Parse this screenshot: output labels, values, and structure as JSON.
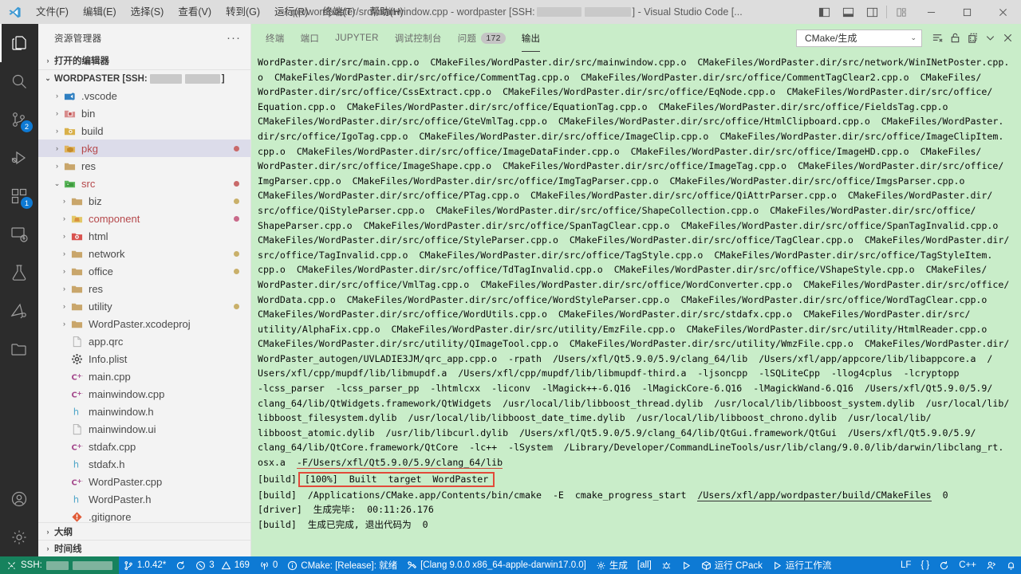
{
  "titlebar": {
    "menus": [
      "文件(F)",
      "编辑(E)",
      "选择(S)",
      "查看(V)",
      "转到(G)",
      "运行(R)",
      "终端(T)",
      "帮助(H)"
    ],
    "title_prefix": "~/app/wordpaster/src/mainwindow.cpp - wordpaster [SSH:",
    "title_suffix": "] - Visual Studio Code [...",
    "layout_icons": [
      "toggle-primary-sidebar-icon",
      "toggle-panel-icon",
      "toggle-secondary-sidebar-icon",
      "customize-layout-icon"
    ],
    "window_controls": [
      "minimize",
      "maximize",
      "close"
    ]
  },
  "activitybar": {
    "items": [
      {
        "name": "explorer",
        "icon": "files-icon",
        "badge": "",
        "active": true
      },
      {
        "name": "search",
        "icon": "search-icon",
        "badge": "",
        "active": false
      },
      {
        "name": "source-control",
        "icon": "source-control-icon",
        "badge": "2",
        "active": false
      },
      {
        "name": "run-and-debug",
        "icon": "debug-icon",
        "badge": "",
        "active": false
      },
      {
        "name": "extensions",
        "icon": "extensions-icon",
        "badge": "1",
        "active": false
      },
      {
        "name": "remote-explorer",
        "icon": "remote-explorer-icon",
        "badge": "",
        "active": false
      },
      {
        "name": "testing",
        "icon": "beaker-icon",
        "badge": "",
        "active": false
      },
      {
        "name": "cmake-tools",
        "icon": "cmake-icon",
        "badge": "",
        "active": false
      },
      {
        "name": "project-manager",
        "icon": "folder-icon",
        "badge": "",
        "active": false
      }
    ],
    "bottom_items": [
      {
        "name": "accounts",
        "icon": "account-icon"
      },
      {
        "name": "manage",
        "icon": "gear-icon"
      }
    ]
  },
  "sidebar": {
    "title": "资源管理器",
    "more_actions": "···",
    "open_editors": "打开的编辑器",
    "workspace_prefix": "WORDPASTER [SSH:",
    "workspace_suffix": "]",
    "outline": "大纲",
    "timeline": "时间线",
    "tree": [
      {
        "label": ".vscode",
        "indent": 1,
        "type": "folder",
        "icon": "vscode-folder-icon",
        "twisty": "›",
        "dot": ""
      },
      {
        "label": "bin",
        "indent": 1,
        "type": "folder",
        "icon": "bin-folder-icon",
        "twisty": "›",
        "dot": ""
      },
      {
        "label": "build",
        "indent": 1,
        "type": "folder",
        "icon": "build-folder-icon",
        "twisty": "›",
        "dot": ""
      },
      {
        "label": "pkg",
        "indent": 1,
        "type": "folder",
        "icon": "pkg-folder-icon",
        "twisty": "›",
        "dot": "#c96a6a",
        "selected": true,
        "color": "#b5484b"
      },
      {
        "label": "res",
        "indent": 1,
        "type": "folder",
        "icon": "folder-icon",
        "twisty": "›",
        "dot": ""
      },
      {
        "label": "src",
        "indent": 1,
        "type": "folder",
        "icon": "src-folder-icon",
        "twisty": "⌄",
        "dot": "#c96a6a",
        "color": "#b5484b"
      },
      {
        "label": "biz",
        "indent": 2,
        "type": "folder",
        "icon": "folder-icon",
        "twisty": "›",
        "dot": "#c9b06a"
      },
      {
        "label": "component",
        "indent": 2,
        "type": "folder",
        "icon": "component-folder-icon",
        "twisty": "›",
        "dot": "#c96a8a",
        "color": "#b5484b"
      },
      {
        "label": "html",
        "indent": 2,
        "type": "folder",
        "icon": "html-folder-icon",
        "twisty": "›",
        "dot": ""
      },
      {
        "label": "network",
        "indent": 2,
        "type": "folder",
        "icon": "folder-icon",
        "twisty": "›",
        "dot": "#c9b06a"
      },
      {
        "label": "office",
        "indent": 2,
        "type": "folder",
        "icon": "folder-icon",
        "twisty": "›",
        "dot": "#c9b06a"
      },
      {
        "label": "res",
        "indent": 2,
        "type": "folder",
        "icon": "folder-icon",
        "twisty": "›",
        "dot": ""
      },
      {
        "label": "utility",
        "indent": 2,
        "type": "folder",
        "icon": "folder-icon",
        "twisty": "›",
        "dot": "#c9b06a"
      },
      {
        "label": "WordPaster.xcodeproj",
        "indent": 2,
        "type": "folder",
        "icon": "folder-icon",
        "twisty": "›",
        "dot": ""
      },
      {
        "label": "app.qrc",
        "indent": 2,
        "type": "file",
        "icon": "file-icon",
        "twisty": "",
        "dot": ""
      },
      {
        "label": "Info.plist",
        "indent": 2,
        "type": "file",
        "icon": "plist-icon",
        "twisty": "",
        "dot": ""
      },
      {
        "label": "main.cpp",
        "indent": 2,
        "type": "file",
        "icon": "cpp-icon",
        "twisty": "",
        "dot": ""
      },
      {
        "label": "mainwindow.cpp",
        "indent": 2,
        "type": "file",
        "icon": "cpp-icon",
        "twisty": "",
        "dot": ""
      },
      {
        "label": "mainwindow.h",
        "indent": 2,
        "type": "file",
        "icon": "h-icon",
        "twisty": "",
        "dot": ""
      },
      {
        "label": "mainwindow.ui",
        "indent": 2,
        "type": "file",
        "icon": "file-icon",
        "twisty": "",
        "dot": ""
      },
      {
        "label": "stdafx.cpp",
        "indent": 2,
        "type": "file",
        "icon": "cpp-icon",
        "twisty": "",
        "dot": ""
      },
      {
        "label": "stdafx.h",
        "indent": 2,
        "type": "file",
        "icon": "h-icon",
        "twisty": "",
        "dot": ""
      },
      {
        "label": "WordPaster.cpp",
        "indent": 2,
        "type": "file",
        "icon": "cpp-icon",
        "twisty": "",
        "dot": ""
      },
      {
        "label": "WordPaster.h",
        "indent": 2,
        "type": "file",
        "icon": "h-icon",
        "twisty": "",
        "dot": ""
      },
      {
        "label": ".gitignore",
        "indent": 2,
        "type": "file",
        "icon": "git-icon",
        "twisty": "",
        "dot": ""
      }
    ]
  },
  "panel": {
    "tabs": [
      {
        "label": "终端",
        "count": "",
        "active": false
      },
      {
        "label": "端口",
        "count": "",
        "active": false
      },
      {
        "label": "JUPYTER",
        "count": "",
        "active": false
      },
      {
        "label": "调试控制台",
        "count": "",
        "active": false
      },
      {
        "label": "问题",
        "count": "172",
        "active": false
      },
      {
        "label": "输出",
        "count": "",
        "active": true
      }
    ],
    "channel_selected": "CMake/生成",
    "actions": [
      {
        "name": "clear-output-icon"
      },
      {
        "name": "lock-icon"
      },
      {
        "name": "split-editor-icon"
      },
      {
        "name": "chevron-down-icon"
      },
      {
        "name": "close-panel-icon"
      }
    ],
    "output_lines": [
      "WordPaster.dir/src/main.cpp.o  CMakeFiles/WordPaster.dir/src/mainwindow.cpp.o  CMakeFiles/WordPaster.dir/src/network/WinINetPoster.cpp.",
      "o  CMakeFiles/WordPaster.dir/src/office/CommentTag.cpp.o  CMakeFiles/WordPaster.dir/src/office/CommentTagClear2.cpp.o  CMakeFiles/",
      "WordPaster.dir/src/office/CssExtract.cpp.o  CMakeFiles/WordPaster.dir/src/office/EqNode.cpp.o  CMakeFiles/WordPaster.dir/src/office/",
      "Equation.cpp.o  CMakeFiles/WordPaster.dir/src/office/EquationTag.cpp.o  CMakeFiles/WordPaster.dir/src/office/FieldsTag.cpp.o",
      "CMakeFiles/WordPaster.dir/src/office/GteVmlTag.cpp.o  CMakeFiles/WordPaster.dir/src/office/HtmlClipboard.cpp.o  CMakeFiles/WordPaster.",
      "dir/src/office/IgoTag.cpp.o  CMakeFiles/WordPaster.dir/src/office/ImageClip.cpp.o  CMakeFiles/WordPaster.dir/src/office/ImageClipItem.",
      "cpp.o  CMakeFiles/WordPaster.dir/src/office/ImageDataFinder.cpp.o  CMakeFiles/WordPaster.dir/src/office/ImageHD.cpp.o  CMakeFiles/",
      "WordPaster.dir/src/office/ImageShape.cpp.o  CMakeFiles/WordPaster.dir/src/office/ImageTag.cpp.o  CMakeFiles/WordPaster.dir/src/office/",
      "ImgParser.cpp.o  CMakeFiles/WordPaster.dir/src/office/ImgTagParser.cpp.o  CMakeFiles/WordPaster.dir/src/office/ImgsParser.cpp.o",
      "CMakeFiles/WordPaster.dir/src/office/PTag.cpp.o  CMakeFiles/WordPaster.dir/src/office/QiAttrParser.cpp.o  CMakeFiles/WordPaster.dir/",
      "src/office/QiStyleParser.cpp.o  CMakeFiles/WordPaster.dir/src/office/ShapeCollection.cpp.o  CMakeFiles/WordPaster.dir/src/office/",
      "ShapeParser.cpp.o  CMakeFiles/WordPaster.dir/src/office/SpanTagClear.cpp.o  CMakeFiles/WordPaster.dir/src/office/SpanTagInvalid.cpp.o",
      "CMakeFiles/WordPaster.dir/src/office/StyleParser.cpp.o  CMakeFiles/WordPaster.dir/src/office/TagClear.cpp.o  CMakeFiles/WordPaster.dir/",
      "src/office/TagInvalid.cpp.o  CMakeFiles/WordPaster.dir/src/office/TagStyle.cpp.o  CMakeFiles/WordPaster.dir/src/office/TagStyleItem.",
      "cpp.o  CMakeFiles/WordPaster.dir/src/office/TdTagInvalid.cpp.o  CMakeFiles/WordPaster.dir/src/office/VShapeStyle.cpp.o  CMakeFiles/",
      "WordPaster.dir/src/office/VmlTag.cpp.o  CMakeFiles/WordPaster.dir/src/office/WordConverter.cpp.o  CMakeFiles/WordPaster.dir/src/office/",
      "WordData.cpp.o  CMakeFiles/WordPaster.dir/src/office/WordStyleParser.cpp.o  CMakeFiles/WordPaster.dir/src/office/WordTagClear.cpp.o",
      "CMakeFiles/WordPaster.dir/src/office/WordUtils.cpp.o  CMakeFiles/WordPaster.dir/src/stdafx.cpp.o  CMakeFiles/WordPaster.dir/src/",
      "utility/AlphaFix.cpp.o  CMakeFiles/WordPaster.dir/src/utility/EmzFile.cpp.o  CMakeFiles/WordPaster.dir/src/utility/HtmlReader.cpp.o",
      "CMakeFiles/WordPaster.dir/src/utility/QImageTool.cpp.o  CMakeFiles/WordPaster.dir/src/utility/WmzFile.cpp.o  CMakeFiles/WordPaster.dir/",
      "WordPaster_autogen/UVLADIE3JM/qrc_app.cpp.o  -rpath  /Users/xfl/Qt5.9.0/5.9/clang_64/lib  /Users/xfl/app/appcore/lib/libappcore.a  /",
      "Users/xfl/cpp/mupdf/lib/libmupdf.a  /Users/xfl/cpp/mupdf/lib/libmupdf-third.a  -ljsoncpp  -lSQLiteCpp  -llog4cplus  -lcryptopp",
      "-lcss_parser  -lcss_parser_pp  -lhtmlcxx  -liconv  -lMagick++-6.Q16  -lMagickCore-6.Q16  -lMagickWand-6.Q16  /Users/xfl/Qt5.9.0/5.9/",
      "clang_64/lib/QtWidgets.framework/QtWidgets  /usr/local/lib/libboost_thread.dylib  /usr/local/lib/libboost_system.dylib  /usr/local/lib/",
      "libboost_filesystem.dylib  /usr/local/lib/libboost_date_time.dylib  /usr/local/lib/libboost_chrono.dylib  /usr/local/lib/",
      "libboost_atomic.dylib  /usr/lib/libcurl.dylib  /Users/xfl/Qt5.9.0/5.9/clang_64/lib/QtGui.framework/QtGui  /Users/xfl/Qt5.9.0/5.9/",
      "clang_64/lib/QtCore.framework/QtCore  -lc++  -lSystem  /Library/Developer/CommandLineTools/usr/lib/clang/9.0.0/lib/darwin/libclang_rt."
    ],
    "tail": {
      "osx_prefix": "osx.a  ",
      "osx_underlined": "-F/Users/xfl/Qt5.9.0/5.9/clang_64/lib",
      "built_tag": "[build]",
      "built_boxed": "[100%]  Built  target  WordPaster",
      "progress_tag": "[build]",
      "progress_text": "  /Applications/CMake.app/Contents/bin/cmake  -E  cmake_progress_start  ",
      "progress_link": "/Users/xfl/app/wordpaster/build/CMakeFiles",
      "progress_zero": "  0",
      "driver_tag": "[driver]",
      "driver_text": "  生成完毕:  00:11:26.176",
      "done_tag": "[build]",
      "done_text": "  生成已完成, 退出代码为  0"
    }
  },
  "statusbar": {
    "remote_label": "SSH:",
    "left_items": [
      {
        "icon": "source-control-icon",
        "label": "1.0.42*"
      },
      {
        "icon": "sync-icon",
        "label": ""
      },
      {
        "icon": "error-icon",
        "label": "3",
        "icon2": "warning-icon",
        "label2": "169"
      },
      {
        "icon": "radio-tower-icon",
        "label": "0"
      },
      {
        "icon": "info-icon",
        "label": "CMake: [Release]: 就绪"
      },
      {
        "icon": "tools-icon",
        "label": "[Clang 9.0.0 x86_64-apple-darwin17.0.0]"
      },
      {
        "icon": "gear-icon",
        "label": "生成"
      },
      {
        "icon": "",
        "label": "[all]"
      },
      {
        "icon": "debug-bug-icon",
        "label": ""
      },
      {
        "icon": "play-icon",
        "label": ""
      },
      {
        "icon": "package-icon",
        "label": "运行 CPack"
      },
      {
        "icon": "play-icon",
        "label": "运行工作流"
      }
    ],
    "right_items": [
      {
        "icon": "",
        "label": "LF"
      },
      {
        "icon": "",
        "label": "{ }"
      },
      {
        "icon": "sync-icon",
        "label": ""
      },
      {
        "icon": "",
        "label": "C++"
      },
      {
        "icon": "feedback-icon",
        "label": ""
      },
      {
        "icon": "bell-icon",
        "label": ""
      }
    ]
  }
}
